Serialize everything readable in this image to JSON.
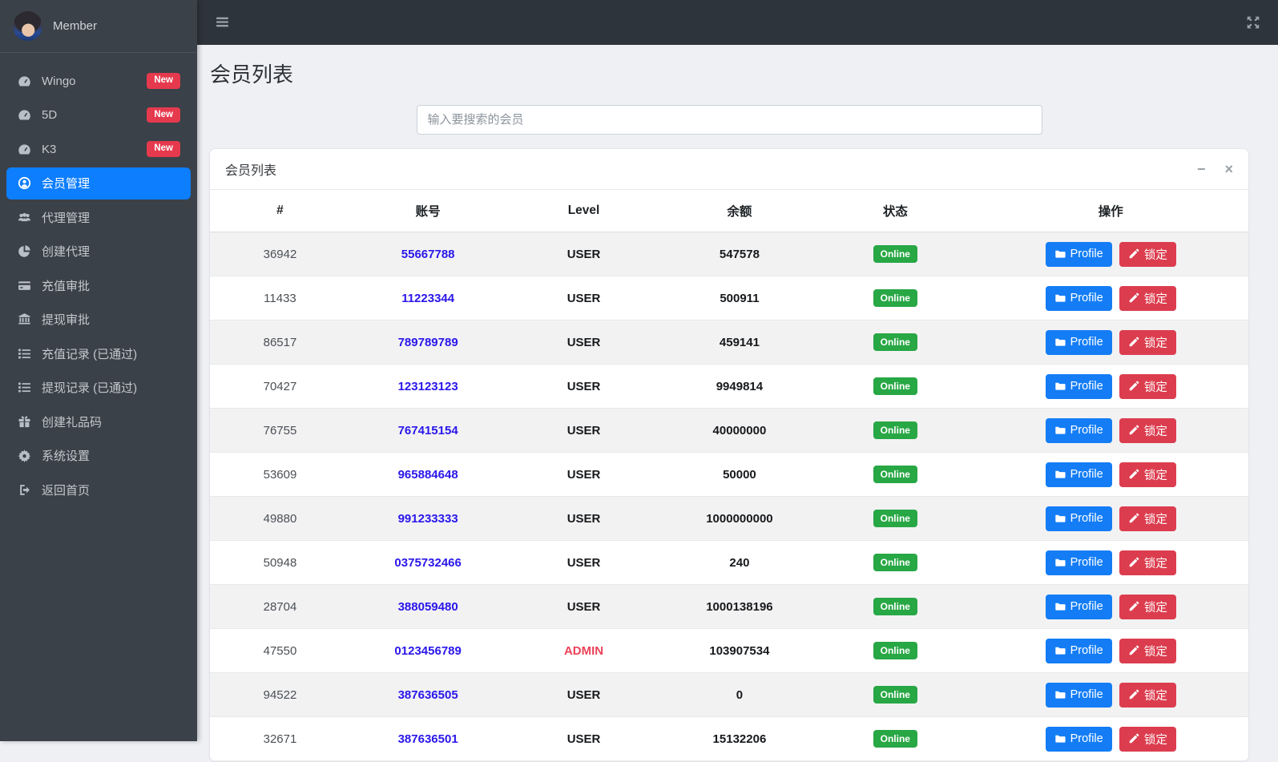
{
  "sidebar": {
    "brand": {
      "label": "Member"
    },
    "items": [
      {
        "key": "wingo",
        "label": "Wingo",
        "icon": "tachometer-icon",
        "badge": "New",
        "active": false
      },
      {
        "key": "5d",
        "label": "5D",
        "icon": "tachometer-icon",
        "badge": "New",
        "active": false
      },
      {
        "key": "k3",
        "label": "K3",
        "icon": "tachometer-icon",
        "badge": "New",
        "active": false
      },
      {
        "key": "member-manage",
        "label": "会员管理",
        "icon": "user-circle-icon",
        "badge": "",
        "active": true
      },
      {
        "key": "agent-manage",
        "label": "代理管理",
        "icon": "users-icon",
        "badge": "",
        "active": false
      },
      {
        "key": "create-agent",
        "label": "创建代理",
        "icon": "pie-chart-icon",
        "badge": "",
        "active": false
      },
      {
        "key": "recharge-approve",
        "label": "充值审批",
        "icon": "credit-card-icon",
        "badge": "",
        "active": false
      },
      {
        "key": "withdraw-approve",
        "label": "提现审批",
        "icon": "bank-icon",
        "badge": "",
        "active": false
      },
      {
        "key": "recharge-records",
        "label": "充值记录 (已通过)",
        "icon": "list-icon",
        "badge": "",
        "active": false
      },
      {
        "key": "withdraw-records",
        "label": "提现记录 (已通过)",
        "icon": "list-icon",
        "badge": "",
        "active": false
      },
      {
        "key": "create-giftcode",
        "label": "创建礼品码",
        "icon": "gift-icon",
        "badge": "",
        "active": false
      },
      {
        "key": "system-settings",
        "label": "系统设置",
        "icon": "gear-icon",
        "badge": "",
        "active": false
      },
      {
        "key": "back-home",
        "label": "返回首页",
        "icon": "logout-icon",
        "badge": "",
        "active": false
      }
    ]
  },
  "navbar": {
    "menu_icon": "hamburger-icon",
    "fullscreen_icon": "expand-icon"
  },
  "page": {
    "title": "会员列表"
  },
  "search": {
    "placeholder": "输入要搜索的会员",
    "value": ""
  },
  "card": {
    "title": "会员列表",
    "minimize_icon": "minus-icon",
    "close_icon": "close-icon",
    "minimize_glyph": "−",
    "close_glyph": "×"
  },
  "table": {
    "headers": [
      "#",
      "账号",
      "Level",
      "余额",
      "状态",
      "操作"
    ],
    "actions": {
      "profile_label": "Profile",
      "lock_label": "锁定"
    },
    "rows": [
      {
        "id": "36942",
        "account": "55667788",
        "level": "USER",
        "balance": "547578",
        "status": "Online"
      },
      {
        "id": "11433",
        "account": "11223344",
        "level": "USER",
        "balance": "500911",
        "status": "Online"
      },
      {
        "id": "86517",
        "account": "789789789",
        "level": "USER",
        "balance": "459141",
        "status": "Online"
      },
      {
        "id": "70427",
        "account": "123123123",
        "level": "USER",
        "balance": "9949814",
        "status": "Online"
      },
      {
        "id": "76755",
        "account": "767415154",
        "level": "USER",
        "balance": "40000000",
        "status": "Online"
      },
      {
        "id": "53609",
        "account": "965884648",
        "level": "USER",
        "balance": "50000",
        "status": "Online"
      },
      {
        "id": "49880",
        "account": "991233333",
        "level": "USER",
        "balance": "1000000000",
        "status": "Online"
      },
      {
        "id": "50948",
        "account": "0375732466",
        "level": "USER",
        "balance": "240",
        "status": "Online"
      },
      {
        "id": "28704",
        "account": "388059480",
        "level": "USER",
        "balance": "1000138196",
        "status": "Online"
      },
      {
        "id": "47550",
        "account": "0123456789",
        "level": "ADMIN",
        "balance": "103907534",
        "status": "Online"
      },
      {
        "id": "94522",
        "account": "387636505",
        "level": "USER",
        "balance": "0",
        "status": "Online"
      },
      {
        "id": "32671",
        "account": "387636501",
        "level": "USER",
        "balance": "15132206",
        "status": "Online"
      }
    ]
  },
  "colors": {
    "sidebar_bg": "#3a4149",
    "navbar_bg": "#2e343b",
    "content_bg": "#eef0f4",
    "active_item": "#0d7efd",
    "link_blue": "#2a16ea",
    "profile_btn": "#147df5",
    "lock_btn": "#dc3d4e",
    "status_green": "#28a745",
    "badge_red": "#e5394d",
    "admin_red": "#e94358"
  }
}
